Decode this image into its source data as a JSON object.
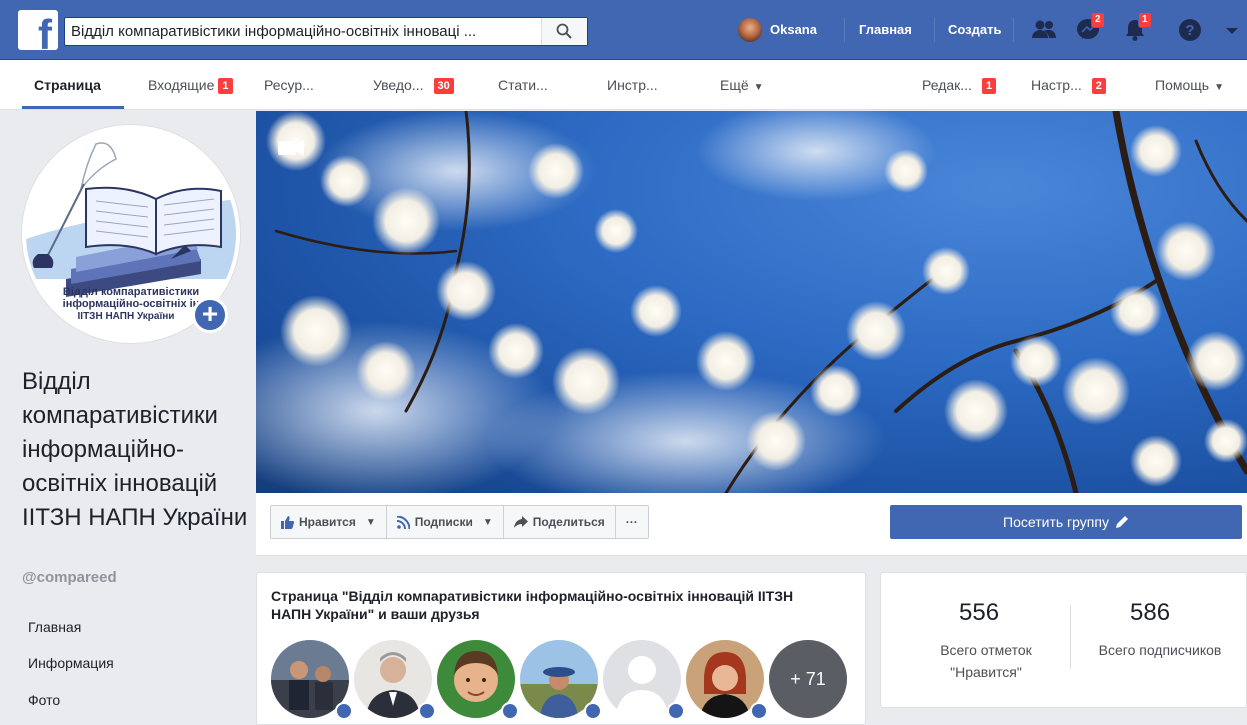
{
  "topbar": {
    "search_value": "Відділ компаративістики інформаційно-освітніх інноваці ...",
    "user_name": "Oksana",
    "home_label": "Главная",
    "create_label": "Создать",
    "messages_badge": "2",
    "notifications_badge": "1"
  },
  "tabs": [
    {
      "label": "Страница"
    },
    {
      "label": "Входящие",
      "badge": "1"
    },
    {
      "label": "Ресур..."
    },
    {
      "label": "Уведо...",
      "badge": "30"
    },
    {
      "label": "Стати..."
    },
    {
      "label": "Инстр..."
    },
    {
      "label": "Ещё"
    },
    {
      "label": "Редак...",
      "badge": "1"
    },
    {
      "label": "Настр...",
      "badge": "2"
    },
    {
      "label": "Помощь"
    }
  ],
  "page": {
    "logo_text": [
      "Відділ компаративістики",
      "інформаційно-освітніх ін",
      "ІІТЗН НАПН України"
    ],
    "name": "Відділ компаративістики інформаційно-освітніх інновацій ІІТЗН НАПН України",
    "handle": "@compareed"
  },
  "nav": [
    "Главная",
    "Информация",
    "Фото"
  ],
  "actions": {
    "like": "Нравится",
    "subscriptions": "Подписки",
    "share": "Поделиться",
    "more": "···",
    "visit_group": "Посетить группу"
  },
  "friends": {
    "title": "Страница \"Відділ компаративістики інформаційно-освітніх інновацій ІІТЗН НАПН України\" и ваши друзья",
    "more": "+ 71"
  },
  "stats": {
    "likes_count": "556",
    "likes_label": "Всего отметок \"Нравится\"",
    "followers_count": "586",
    "followers_label": "Всего подписчиков"
  },
  "colors": {
    "brand": "#4267b2",
    "badge": "#fa3e3e",
    "background": "#e9ebee"
  }
}
